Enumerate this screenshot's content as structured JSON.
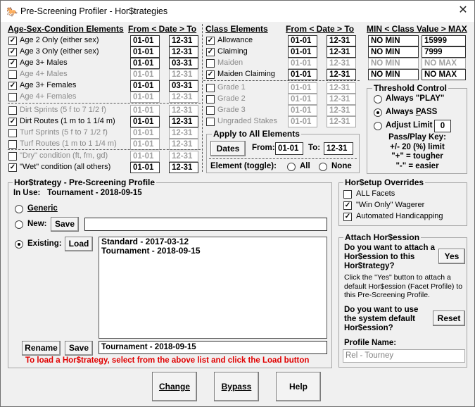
{
  "window": {
    "title": "Pre-Screening Profiler - Hor$trategies",
    "close": "✕"
  },
  "asc": {
    "header": "Age-Sex-Condition Elements",
    "from_date_to": "From < Date > To",
    "items": [
      {
        "label": "Age 2 Only (either sex)",
        "checked": true,
        "from": "01-01",
        "to": "12-31"
      },
      {
        "label": "Age 3 Only (either sex)",
        "checked": true,
        "from": "01-01",
        "to": "12-31"
      },
      {
        "label": "Age 3+ Males",
        "checked": true,
        "from": "01-01",
        "to": "03-31"
      },
      {
        "label": "Age 4+ Males",
        "checked": false,
        "from": "01-01",
        "to": "12-31"
      },
      {
        "label": "Age 3+ Females",
        "checked": true,
        "from": "01-01",
        "to": "03-31"
      },
      {
        "label": "Age 4+ Females",
        "checked": false,
        "from": "01-01",
        "to": "12-31"
      },
      {
        "label": "Dirt Sprints (5 f to 7 1/2 f)",
        "checked": false,
        "from": "01-01",
        "to": "12-31"
      },
      {
        "label": "Dirt Routes (1 m to 1 1/4 m)",
        "checked": true,
        "from": "01-01",
        "to": "12-31"
      },
      {
        "label": "Turf Sprints (5 f to 7 1/2 f)",
        "checked": false,
        "from": "01-01",
        "to": "12-31"
      },
      {
        "label": "Turf Routes (1 m to 1 1/4 m)",
        "checked": false,
        "from": "01-01",
        "to": "12-31"
      },
      {
        "label": "\"Dry\" condition (ft, fm, gd)",
        "checked": false,
        "from": "01-01",
        "to": "12-31"
      },
      {
        "label": "\"Wet\" condition (all others)",
        "checked": true,
        "from": "01-01",
        "to": "12-31"
      }
    ]
  },
  "class": {
    "header": "Class Elements",
    "from_date_to": "From < Date > To",
    "value_header": "MIN < Class Value > MAX",
    "items": [
      {
        "label": "Allowance",
        "checked": true,
        "from": "01-01",
        "to": "12-31",
        "min": "NO MIN",
        "max": "15999"
      },
      {
        "label": "Claiming",
        "checked": true,
        "from": "01-01",
        "to": "12-31",
        "min": "NO MIN",
        "max": "7999"
      },
      {
        "label": "Maiden",
        "checked": false,
        "from": "01-01",
        "to": "12-31",
        "min": "NO MIN",
        "max": "NO MAX"
      },
      {
        "label": "Maiden Claiming",
        "checked": true,
        "from": "01-01",
        "to": "12-31",
        "min": "NO MIN",
        "max": "NO MAX"
      },
      {
        "label": "Grade 1",
        "checked": false,
        "from": "01-01",
        "to": "12-31"
      },
      {
        "label": "Grade 2",
        "checked": false,
        "from": "01-01",
        "to": "12-31"
      },
      {
        "label": "Grade 3",
        "checked": false,
        "from": "01-01",
        "to": "12-31"
      },
      {
        "label": "Ungraded Stakes",
        "checked": false,
        "from": "01-01",
        "to": "12-31"
      }
    ]
  },
  "apply": {
    "title": "Apply to All Elements",
    "dates_button": "Dates",
    "from_label": "From:",
    "from": "01-01",
    "to_label": "To:",
    "to": "12-31",
    "toggle_label": "Element (toggle):",
    "all": "All",
    "none": "None"
  },
  "threshold": {
    "title": "Threshold Control",
    "opt1": "Always \"PLAY\"",
    "opt2_pre": "Always ",
    "opt2_u": "P",
    "opt2_post": "ASS",
    "opt3": "Adjust Limit",
    "limit": "0",
    "key": "Pass/Play Key:",
    "line1": "+/- 20 (%) limit",
    "line2": "\"+\" = tougher",
    "line3": "\"-\" = easier"
  },
  "profile": {
    "title": "Hor$trategy - Pre-Screening Profile",
    "in_use_label": "In Use:",
    "in_use": "Tournament - 2018-09-15",
    "generic": "Generic",
    "new_label": "New:",
    "save": "Save",
    "new_value": "",
    "existing_label": "Existing:",
    "load": "Load",
    "list": [
      "Standard - 2017-03-12",
      "Tournament - 2018-09-15"
    ],
    "rename": "Rename",
    "save2": "Save",
    "name_value": "Tournament - 2018-09-15",
    "hint": "To load a Hor$trategy, select from the above list and click the Load button",
    "hint_color": "#e00000"
  },
  "overrides": {
    "title": "Hor$etup Overrides",
    "items": [
      {
        "label": "ALL Facets",
        "checked": false
      },
      {
        "label": "\"Win Only\" Wagerer",
        "checked": true
      },
      {
        "label": "Automated Handicapping",
        "checked": true
      }
    ]
  },
  "attach": {
    "title": "Attach Hor$ession",
    "q1": "Do you want to attach a Hor$ession to this Hor$trategy?",
    "yes": "Yes",
    "desc": "Click the \"Yes\" button to attach a default Hor$ession (Facet Profile) to this Pre-Screening Profile.",
    "q2": "Do you want to use the system default Hor$ession?",
    "reset": "Reset",
    "profile_name_label": "Profile Name:",
    "profile_name": "Rel - Tourney"
  },
  "footer": {
    "change": "Change",
    "bypass": "Bypass",
    "help": "Help"
  }
}
